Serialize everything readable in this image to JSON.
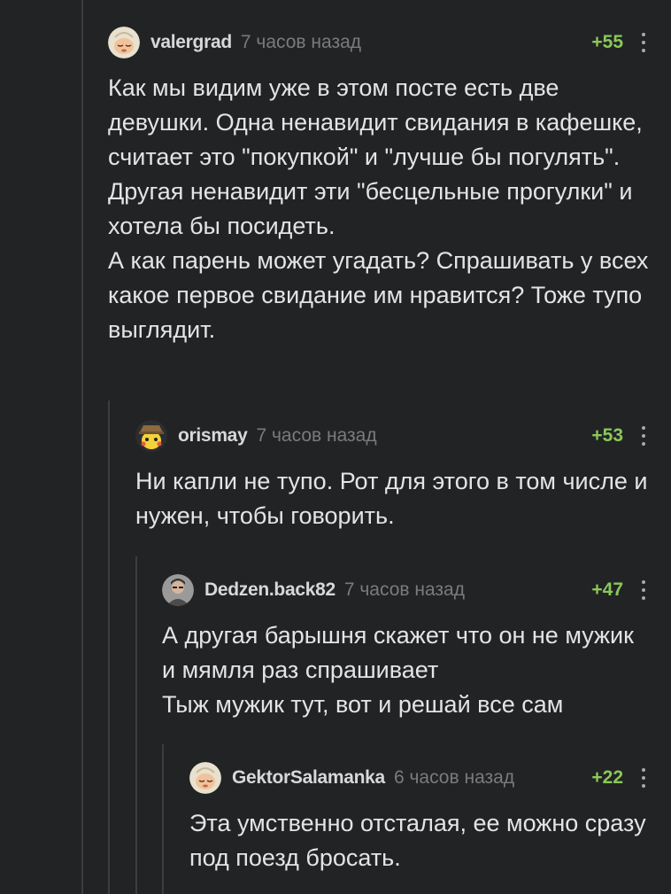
{
  "comments": [
    {
      "username": "valergrad",
      "time": "7 часов назад",
      "rating": "+55",
      "body": "Как мы видим уже в этом посте есть две девушки.  Одна ненавидит свидания в кафешке, считает это \"покупкой\" и \"лучше бы погулять\".\nДругая ненавидит эти \"бесцельные прогулки\" и хотела бы посидеть.\nА как парень может угадать? Спрашивать у всех какое первое свидание им нравится? Тоже тупо выглядит."
    },
    {
      "username": "orismay",
      "time": "7 часов назад",
      "rating": "+53",
      "body": "Ни капли не тупо. Рот для этого в том числе и нужен, чтобы говорить."
    },
    {
      "username": "Dedzen.back82",
      "time": "7 часов назад",
      "rating": "+47",
      "body": "А другая барышня скажет что он не мужик и мямля раз спрашивает\nТыж мужик тут, вот и решай все сам"
    },
    {
      "username": "GektorSalamanka",
      "time": "6 часов назад",
      "rating": "+22",
      "body": "Эта умственно отсталая, ее можно сразу под поезд бросать."
    }
  ],
  "colors": {
    "background": "#222325",
    "rating": "#8ac858",
    "thread_line": "#3b3d40"
  },
  "icons": {
    "avatar_1": "sleepy-face-avatar",
    "avatar_2": "pikachu-detective-avatar",
    "avatar_3": "person-photo-avatar",
    "avatar_4": "sleepy-face-avatar",
    "menu": "more-vertical-icon"
  }
}
